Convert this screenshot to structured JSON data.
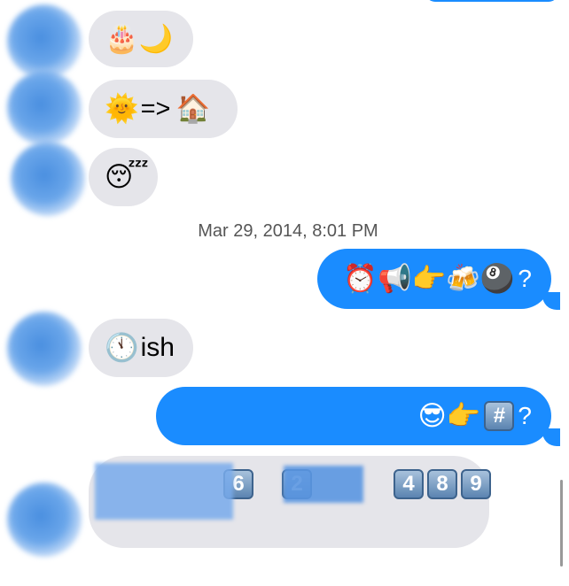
{
  "messages": [
    {
      "id": "m1",
      "dir": "in",
      "content": "🎂🌙"
    },
    {
      "id": "m2",
      "dir": "in",
      "content": "🌞=> 🏠"
    },
    {
      "id": "m3",
      "dir": "in",
      "content": "😴"
    },
    {
      "id": "ts",
      "dir": "time",
      "content": "Mar 29, 2014, 8:01 PM"
    },
    {
      "id": "m4",
      "dir": "out",
      "content": "⏰📢👉🍻🎱?"
    },
    {
      "id": "m5",
      "dir": "in",
      "content": "🕚ish"
    },
    {
      "id": "m6",
      "dir": "out",
      "content": "😎👉#️⃣?"
    },
    {
      "id": "m7",
      "dir": "in",
      "content": "6 2 4 8 9"
    }
  ],
  "ui": {
    "m1": {
      "emoji": "🎂🌙"
    },
    "m2": {
      "emoji": "🌞",
      "text": "=> ",
      "house": "🏠"
    },
    "m3": {
      "emoji": "😴"
    },
    "timestamp": "Mar 29, 2014, 8:01 PM",
    "m4": {
      "emoji": "⏰📢👉🍻🎱",
      "text": "?"
    },
    "m5": {
      "emoji": "🕚",
      "text": "ish"
    },
    "m6": {
      "emoji": "😎👉",
      "key": "#",
      "text": "?"
    },
    "m7": {
      "keys": [
        "6",
        "2",
        "4",
        "8",
        "9"
      ]
    }
  },
  "colors": {
    "incoming": "#e5e5ea",
    "outgoing": "#1a8cff"
  }
}
